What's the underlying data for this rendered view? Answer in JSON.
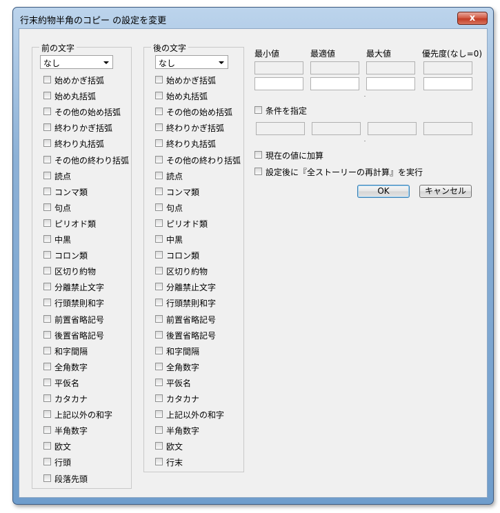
{
  "window": {
    "title": "行末約物半角のコピー の設定を変更",
    "close_label": "x"
  },
  "before_group": {
    "title": "前の文字",
    "combo_value": "なし",
    "items": [
      "始めかぎ括弧",
      "始め丸括弧",
      "その他の始め括弧",
      "終わりかぎ括弧",
      "終わり丸括弧",
      "その他の終わり括弧",
      "読点",
      "コンマ類",
      "句点",
      "ピリオド類",
      "中黒",
      "コロン類",
      "区切り約物",
      "分離禁止文字",
      "行頭禁則和字",
      "前置省略記号",
      "後置省略記号",
      "和字間隔",
      "全角数字",
      "平仮名",
      "カタカナ",
      "上記以外の和字",
      "半角数字",
      "欧文",
      "行頭",
      "段落先頭"
    ]
  },
  "after_group": {
    "title": "後の文字",
    "combo_value": "なし",
    "items": [
      "始めかぎ括弧",
      "始め丸括弧",
      "その他の始め括弧",
      "終わりかぎ括弧",
      "終わり丸括弧",
      "その他の終わり括弧",
      "読点",
      "コンマ類",
      "句点",
      "ピリオド類",
      "中黒",
      "コロン類",
      "区切り約物",
      "分離禁止文字",
      "行頭禁則和字",
      "前置省略記号",
      "後置省略記号",
      "和字間隔",
      "全角数字",
      "平仮名",
      "カタカナ",
      "上記以外の和字",
      "半角数字",
      "欧文",
      "行末"
    ]
  },
  "values": {
    "headers": [
      "最小値",
      "最適値",
      "最大値",
      "優先度(なし=0)"
    ]
  },
  "condition_label": "条件を指定",
  "add_current_label": "現在の値に加算",
  "recompose_label": "設定後に『全ストーリーの再計算』を実行",
  "buttons": {
    "ok": "OK",
    "cancel": "キャンセル"
  }
}
